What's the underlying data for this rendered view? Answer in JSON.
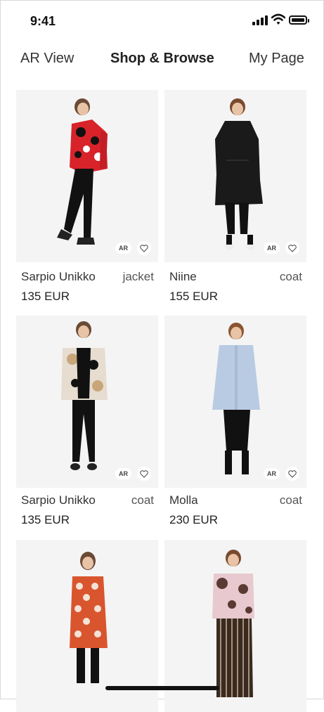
{
  "status_bar": {
    "time": "9:41"
  },
  "tabs": [
    {
      "label": "AR View"
    },
    {
      "label": "Shop & Browse"
    },
    {
      "label": "My Page"
    }
  ],
  "products": [
    {
      "name": "Sarpio Unikko",
      "category": "jacket",
      "price": "135 EUR",
      "ar_badge": "AR"
    },
    {
      "name": "Niine",
      "category": "coat",
      "price": "155 EUR",
      "ar_badge": "AR"
    },
    {
      "name": "Sarpio Unikko",
      "category": "coat",
      "price": "135 EUR",
      "ar_badge": "AR"
    },
    {
      "name": "Molla",
      "category": "coat",
      "price": "230 EUR",
      "ar_badge": "AR"
    },
    {
      "name": "",
      "category": "",
      "price": ""
    },
    {
      "name": "",
      "category": "",
      "price": ""
    }
  ],
  "colors": {
    "accent": "#222222",
    "card_bg": "#f4f4f4",
    "unikko_red": "#d8232a",
    "black": "#111111",
    "light_blue": "#b9cbe2",
    "orange": "#d9552e"
  }
}
